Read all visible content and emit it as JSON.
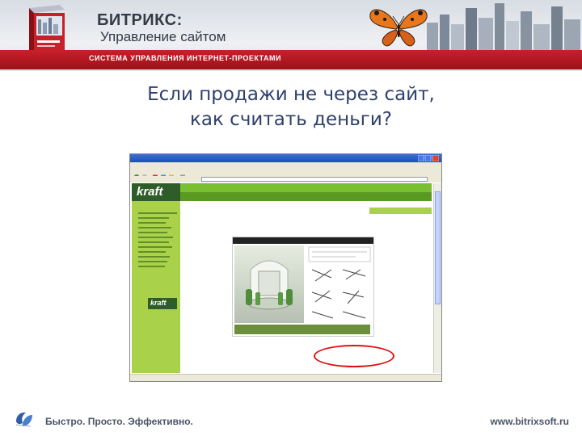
{
  "header": {
    "brand_title": "БИТРИКС:",
    "brand_subtitle": "Управление сайтом",
    "tagline": "СИСТЕМА УПРАВЛЕНИЯ ИНТЕРНЕТ-ПРОЕКТАМИ",
    "accent_color": "#c8202b"
  },
  "slide": {
    "title_line1": "Если продажи не через сайт,",
    "title_line2": "как считать деньги?"
  },
  "screenshot": {
    "site_logo": "kraft",
    "mini_logo": "kraft",
    "oval_color": "#e01010"
  },
  "footer": {
    "slogan": "Быстро. Просто. Эффективно.",
    "url": "www.bitrixsoft.ru"
  }
}
